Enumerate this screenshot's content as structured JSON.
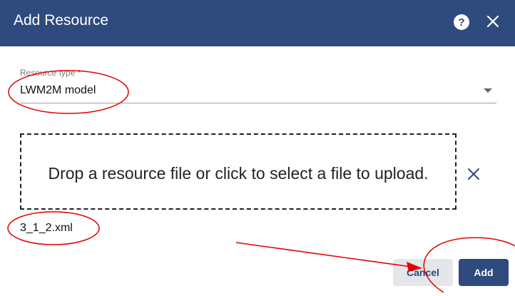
{
  "dialog": {
    "title": "Add Resource",
    "help_icon": "help-circle-icon",
    "close_icon": "close-icon"
  },
  "resource_type": {
    "label": "Resource type *",
    "value": "LWM2M model"
  },
  "upload": {
    "dropzone_text": "Drop a resource file or click to select a file to upload.",
    "clear_icon": "close-icon",
    "file_name": "3_1_2.xml"
  },
  "actions": {
    "cancel_label": "Cancel",
    "add_label": "Add"
  },
  "colors": {
    "header": "#2f4a7d",
    "annotation": "#e00000"
  }
}
